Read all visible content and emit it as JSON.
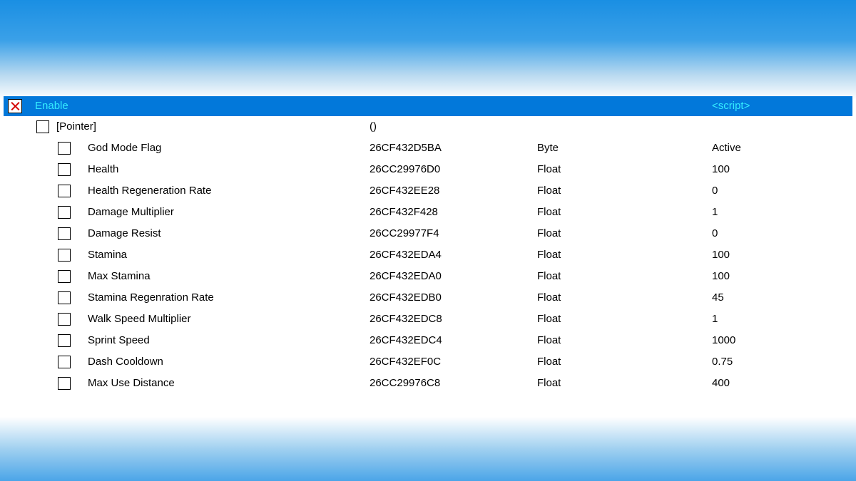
{
  "header": {
    "label": "Enable",
    "value": "<script>"
  },
  "pointer": {
    "label": "[Pointer]",
    "address": "()"
  },
  "rows": [
    {
      "label": "God Mode Flag",
      "address": "26CF432D5BA",
      "type": "Byte",
      "value": "Active"
    },
    {
      "label": "Health",
      "address": "26CC29976D0",
      "type": "Float",
      "value": "100"
    },
    {
      "label": "Health Regeneration Rate",
      "address": "26CF432EE28",
      "type": "Float",
      "value": "0"
    },
    {
      "label": "Damage Multiplier",
      "address": "26CF432F428",
      "type": "Float",
      "value": "1"
    },
    {
      "label": "Damage Resist",
      "address": "26CC29977F4",
      "type": "Float",
      "value": "0"
    },
    {
      "label": "Stamina",
      "address": "26CF432EDA4",
      "type": "Float",
      "value": "100"
    },
    {
      "label": "Max Stamina",
      "address": "26CF432EDA0",
      "type": "Float",
      "value": "100"
    },
    {
      "label": "Stamina Regenration Rate",
      "address": "26CF432EDB0",
      "type": "Float",
      "value": "45"
    },
    {
      "label": "Walk Speed Multiplier",
      "address": "26CF432EDC8",
      "type": "Float",
      "value": "1"
    },
    {
      "label": "Sprint Speed",
      "address": "26CF432EDC4",
      "type": "Float",
      "value": "1000"
    },
    {
      "label": "Dash Cooldown",
      "address": "26CF432EF0C",
      "type": "Float",
      "value": "0.75"
    },
    {
      "label": "Max Use Distance",
      "address": "26CC29976C8",
      "type": "Float",
      "value": "400"
    }
  ]
}
